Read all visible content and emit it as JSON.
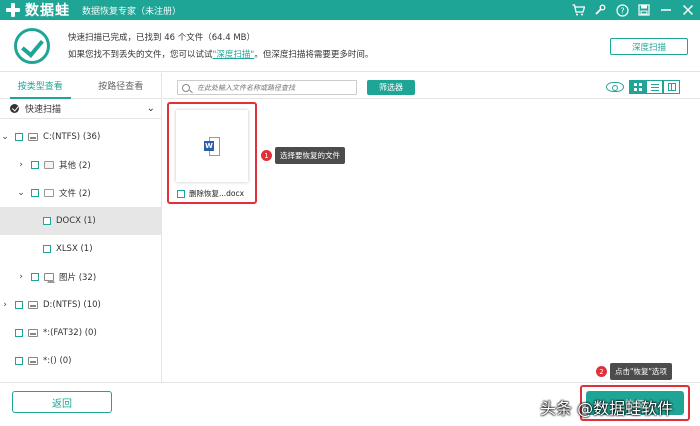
{
  "app": {
    "logo_text": "数据蛙",
    "subtitle": "数据恢复专家（未注册）",
    "title_icons": [
      "cart-icon",
      "wrench-icon",
      "help-icon",
      "save-icon",
      "minimize-icon",
      "close-icon"
    ]
  },
  "status": {
    "line1": "快速扫描已完成，已找到 46 个文件（64.4 MB）",
    "line2_prefix": "如果您找不到丢失的文件，您可以试试",
    "line2_link": "\"深度扫描\"",
    "line2_suffix": "。但深度扫描将需要更多时间。",
    "deep_scan_button": "深度扫描"
  },
  "sidebar": {
    "tabs": [
      {
        "label": "按类型查看",
        "active": true
      },
      {
        "label": "按路径查看",
        "active": false
      }
    ],
    "scan_mode": "快速扫描",
    "tree": [
      {
        "label": "C:(NTFS) (36)",
        "arrow": "⌄"
      },
      {
        "label": "其他 (2)",
        "arrow": "›"
      },
      {
        "label": "文件 (2)",
        "arrow": "⌄"
      },
      {
        "label": "DOCX (1)",
        "arrow": ""
      },
      {
        "label": "XLSX (1)",
        "arrow": ""
      },
      {
        "label": "图片 (32)",
        "arrow": "›"
      },
      {
        "label": "D:(NTFS) (10)",
        "arrow": "›"
      },
      {
        "label": "*:(FAT32) (0)",
        "arrow": ""
      },
      {
        "label": "*:() (0)",
        "arrow": ""
      }
    ]
  },
  "toolbar": {
    "search_placeholder": "在此处输入文件名称或路径查找",
    "filter_button": "筛选器"
  },
  "content": {
    "file_name": "删除恢复...docx",
    "file_icon_letter": "W",
    "tip1_num": "1",
    "tip1_text": "选择要恢复的文件",
    "tip2_num": "2",
    "tip2_text": "点击\"恢复\"选项"
  },
  "bottom": {
    "back_button": "返回",
    "recover_button": "恢复",
    "watermark": "头条 @数据蛙软件"
  },
  "colors": {
    "accent": "#1fa596",
    "highlight": "#e0303a"
  }
}
